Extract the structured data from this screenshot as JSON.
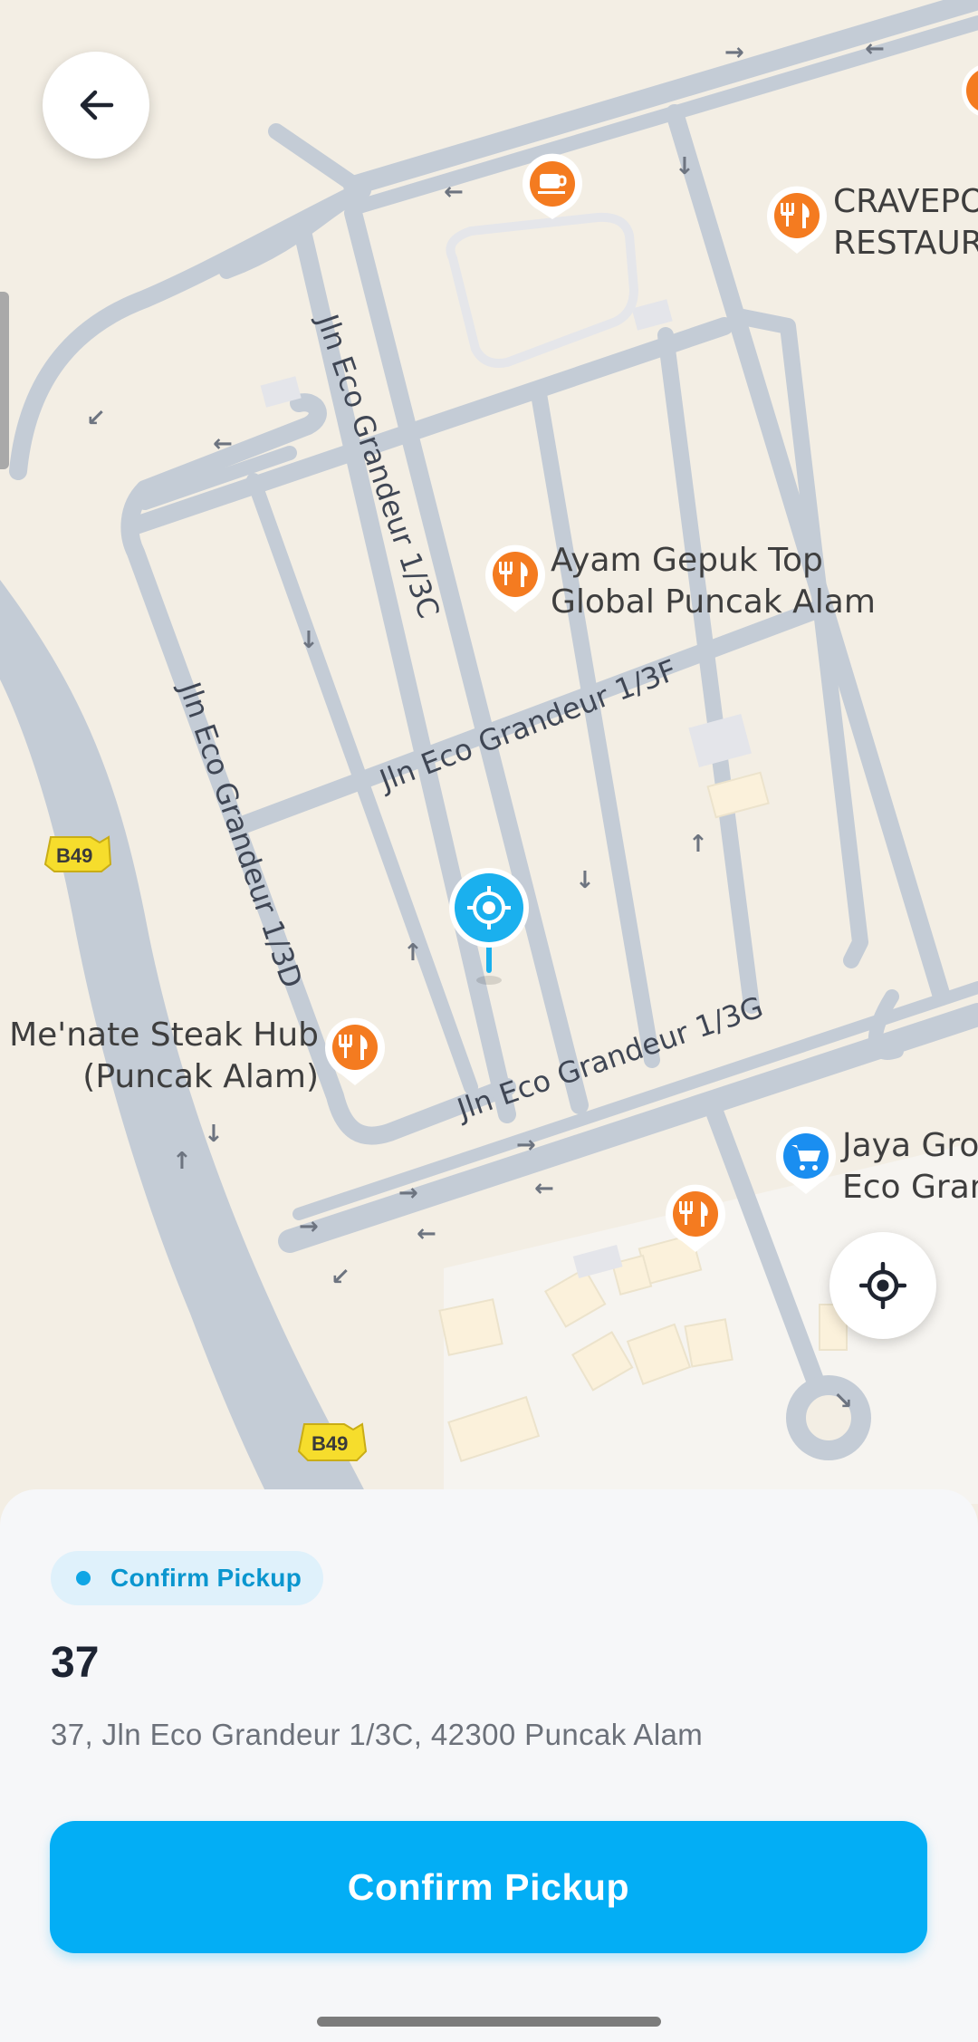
{
  "map": {
    "streets": [
      "Jln Eco Grandeur 1/3C",
      "Jln Eco Grandeur 1/3F",
      "Jln Eco Grandeur 1/3D",
      "Jln Eco Grandeur 1/3G"
    ],
    "road_badges": [
      "B49",
      "B49"
    ],
    "pois": [
      {
        "name_line1": "CRAVEPO",
        "name_line2": "RESTAUR",
        "icon": "fork-knife-icon"
      },
      {
        "name_line1": "Ayam Gepuk Top",
        "name_line2": "Global Puncak Alam",
        "icon": "fork-knife-icon"
      },
      {
        "name_line1": "Me'nate Steak Hub",
        "name_line2": "(Puncak Alam)",
        "icon": "fork-knife-icon"
      },
      {
        "name_line1": "Jaya Gro",
        "name_line2": "Eco Gran",
        "icon": "cart-icon"
      }
    ],
    "colors": {
      "land": "#f3eee4",
      "road": "#c4ccd6",
      "poi_orange": "#f47b20",
      "poi_blue": "#1a8ef0",
      "pin": "#1ab0ee"
    }
  },
  "buttons": {
    "back_icon": "arrow-left-icon",
    "locate_icon": "crosshair-icon"
  },
  "sheet": {
    "status_chip": "Confirm Pickup",
    "title": "37",
    "address": "37, Jln Eco Grandeur 1/3C, 42300 Puncak Alam",
    "confirm_label": "Confirm Pickup"
  },
  "colors": {
    "accent": "#03aef5",
    "chip_bg": "#dff1fb",
    "chip_text": "#0a96cf"
  }
}
